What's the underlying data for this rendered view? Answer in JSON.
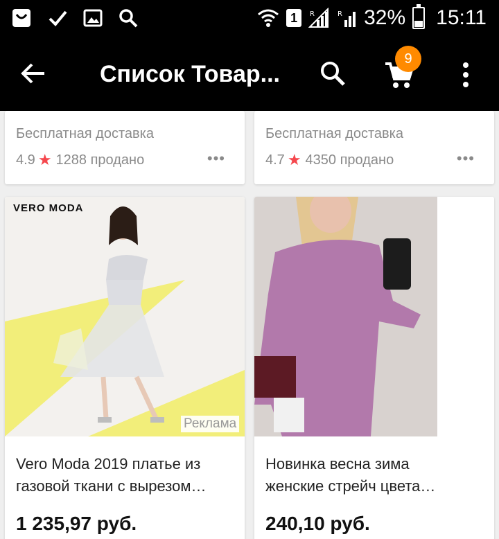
{
  "status_bar": {
    "battery": "32%",
    "time": "15:11",
    "sim": "1",
    "battery_level": 0.32
  },
  "app_bar": {
    "title": "Список Товар...",
    "cart_count": "9"
  },
  "top_cards": [
    {
      "delivery": "Бесплатная доставка",
      "rating": "4.9",
      "sold": "1288 продано"
    },
    {
      "delivery": "Бесплатная доставка",
      "rating": "4.7",
      "sold": "4350 продано"
    }
  ],
  "products": [
    {
      "brand": "VERO MODA",
      "ad_label": "Реклама",
      "title_line1": "Vero Moda 2019 платье из",
      "title_line2": "газовой ткани с вырезом…",
      "price": "1 235,97 руб."
    },
    {
      "title_line1": "Новинка весна зима",
      "title_line2": "женские стрейч цвета…",
      "price": "240,10 руб."
    }
  ],
  "colors": {
    "accent": "#ff8a00",
    "star": "#f5474d",
    "bar": "#000000"
  }
}
